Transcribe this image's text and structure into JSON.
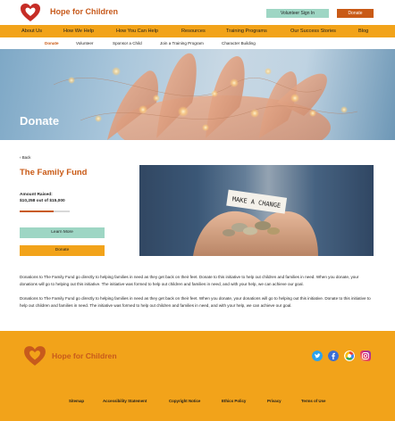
{
  "header": {
    "logo_text": "Hope for Children",
    "volunteer_label": "Volunteer Sign In",
    "donate_label": "Donate"
  },
  "nav": {
    "items": [
      {
        "label": "About Us"
      },
      {
        "label": "How We Help"
      },
      {
        "label": "How You Can Help"
      },
      {
        "label": "Resources"
      },
      {
        "label": "Training Programs"
      },
      {
        "label": "Our Success Stories"
      },
      {
        "label": "Blog"
      }
    ]
  },
  "subnav": {
    "items": [
      {
        "label": "Donate",
        "active": true
      },
      {
        "label": "Volunteer"
      },
      {
        "label": "Sponsor a Child"
      },
      {
        "label": "Join a Training Program"
      },
      {
        "label": "Character Building"
      }
    ]
  },
  "hero": {
    "title": "Donate"
  },
  "content": {
    "back_label": "Back",
    "fund_title": "The Family Fund",
    "raised_label": "Amount Raised:",
    "raised_amount": "$10,258 out of $15,000",
    "progress_fraction": 0.684,
    "learn_more_label": "Learn More",
    "donate_label": "Donate",
    "photo_note_text": "MAKE A CHANGE",
    "paragraph_1": "Donations to The Family Fund go directly to helping families in need as they get back on their feet. Donate to this initiative to help out children and families in need. When you donate, your donations will go to helping out this initiative. The initiative was formed to help out children and families in need, and with your help, we can achieve our goal.",
    "paragraph_2": "Donations to The Family Fund go directly to helping families in need as they get back on their feet. When you donate, your donations will go to helping out this initiative. Donate to this initiative to help out children and families in need. The initiative was formed to help out children and families in need, and with your help, we can achieve our goal."
  },
  "footer": {
    "logo_text": "Hope for Children",
    "social_icons": [
      "twitter-icon",
      "facebook-icon",
      "google-icon",
      "instagram-icon"
    ],
    "links": [
      {
        "label": "Sitemap"
      },
      {
        "label": "Accessibility Statement"
      },
      {
        "label": "Copyright Notice"
      },
      {
        "label": "Ethics Policy"
      },
      {
        "label": "Privacy"
      },
      {
        "label": "Terms of Use"
      }
    ]
  },
  "colors": {
    "brand_orange": "#c95a16",
    "nav_yellow": "#f2a31a",
    "mint": "#9ed6c4"
  }
}
